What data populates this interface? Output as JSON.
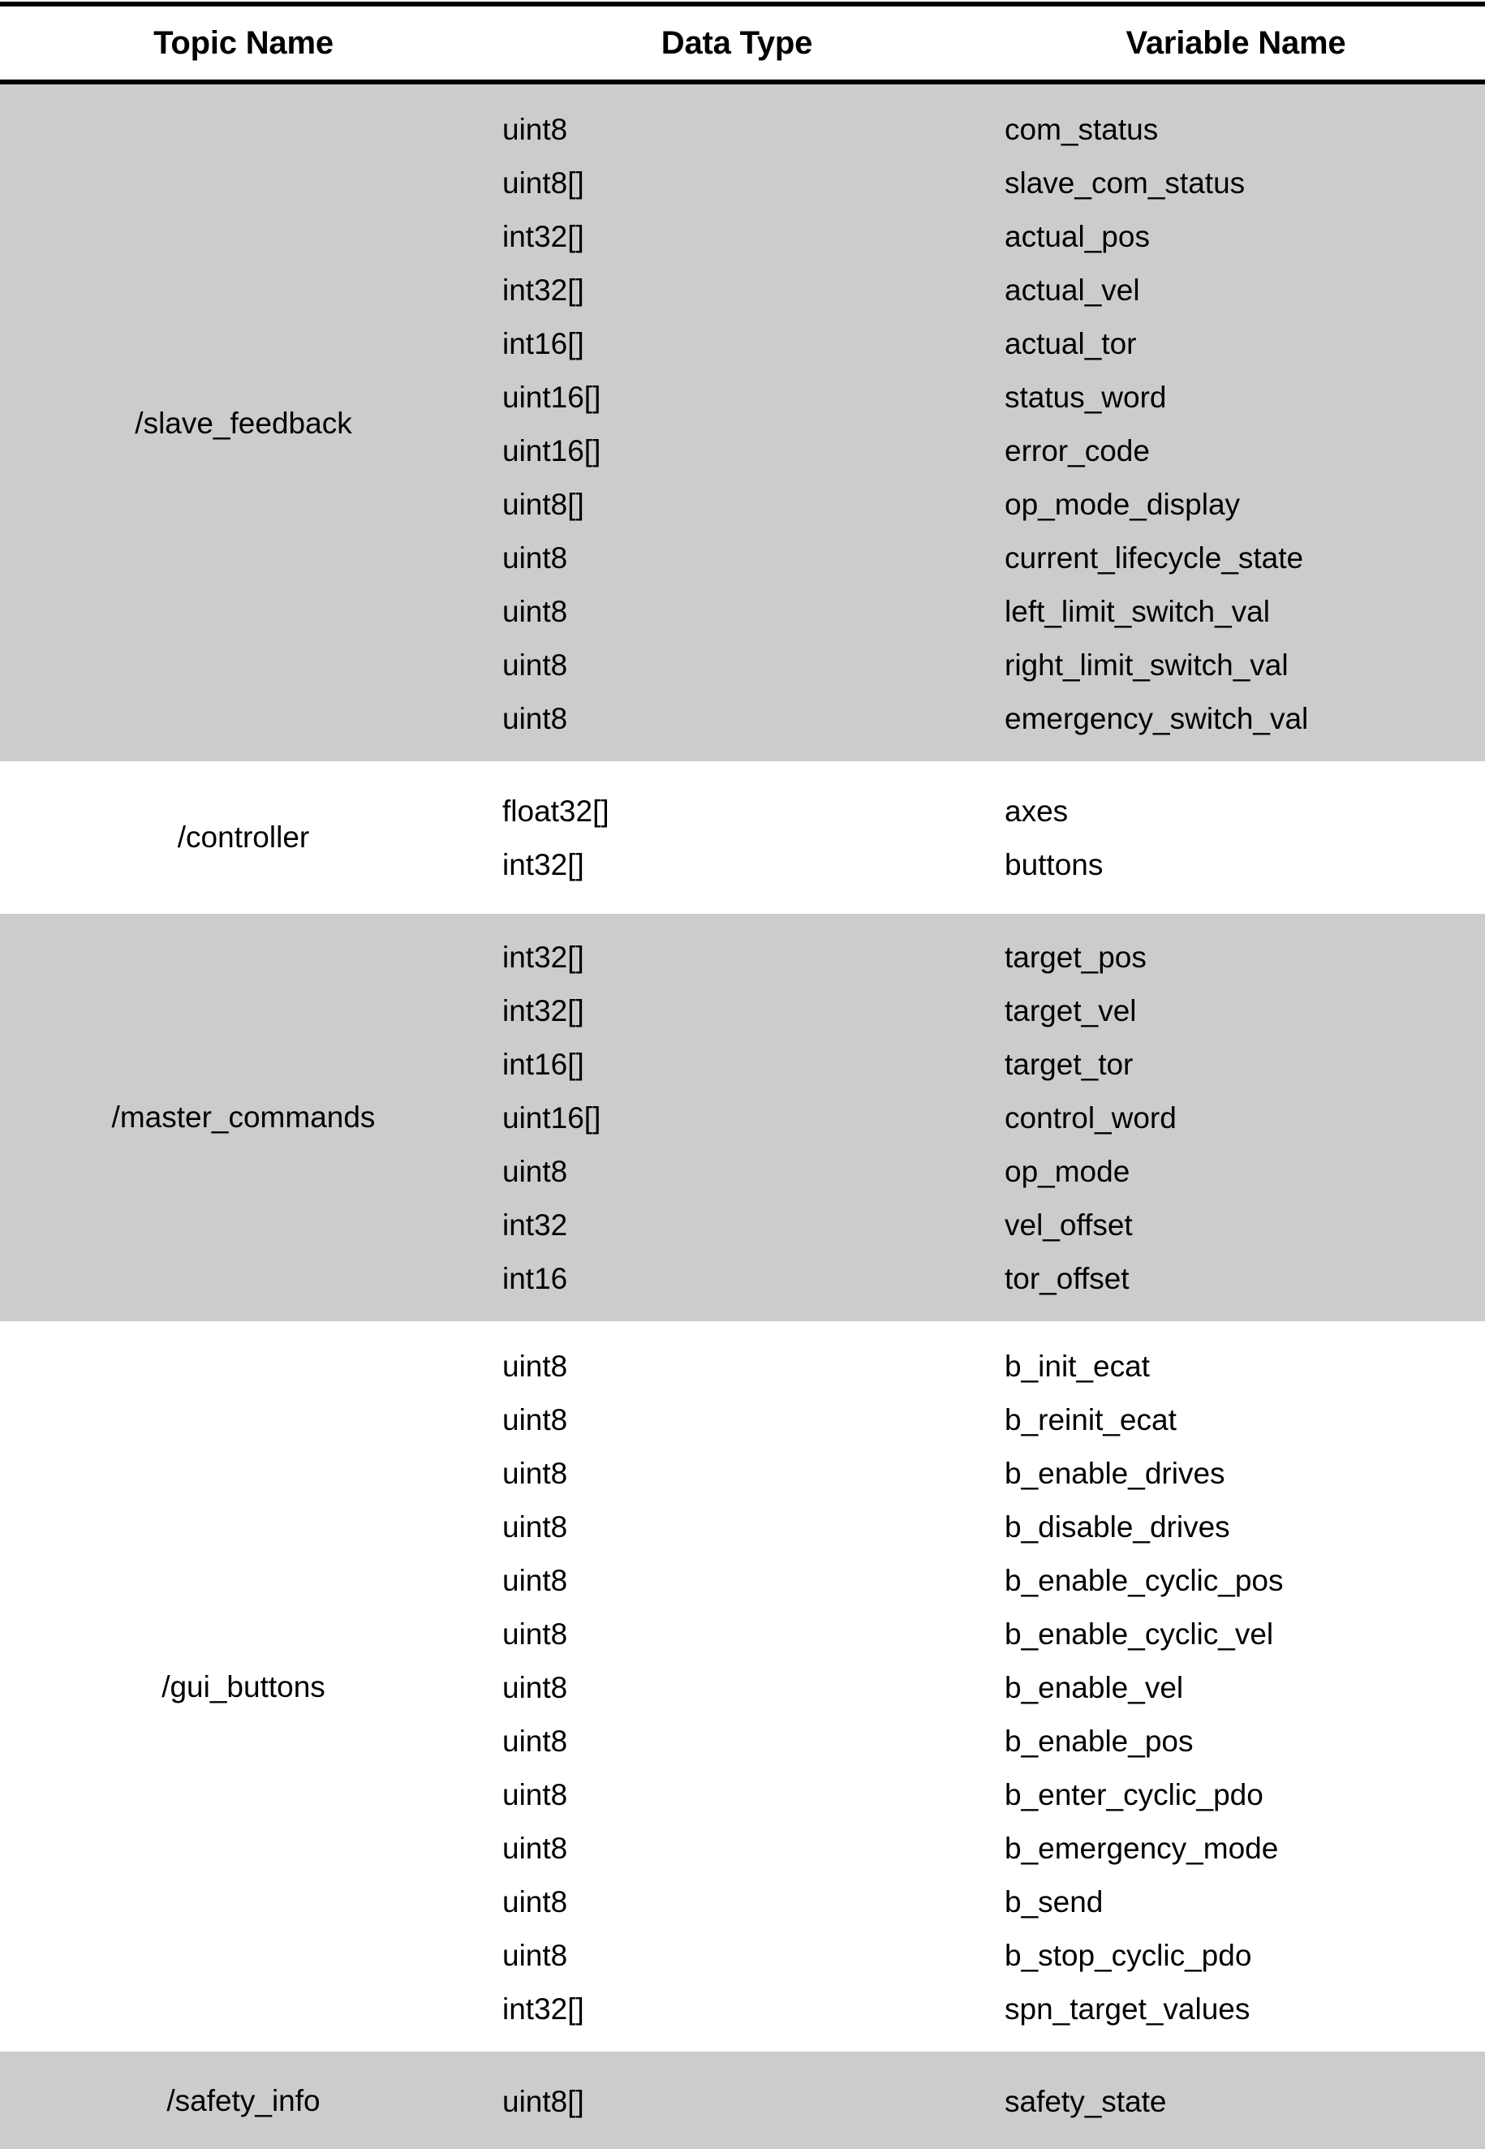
{
  "table": {
    "header": {
      "topic_name": "Topic Name",
      "data_type": "Data Type",
      "variable_name": "Variable Name"
    },
    "colors": {
      "shaded_row": "#CCCCCC",
      "plain_row": "#FFFFFF",
      "rule": "#000000",
      "text": "#000000"
    },
    "sections": [
      {
        "topic": "/slave_feedback",
        "shaded": true,
        "rows": [
          {
            "type": "uint8",
            "variable": "com_status"
          },
          {
            "type": "uint8[]",
            "variable": "slave_com_status"
          },
          {
            "type": "int32[]",
            "variable": "actual_pos"
          },
          {
            "type": "int32[]",
            "variable": "actual_vel"
          },
          {
            "type": "int16[]",
            "variable": "actual_tor"
          },
          {
            "type": "uint16[]",
            "variable": "status_word"
          },
          {
            "type": "uint16[]",
            "variable": "error_code"
          },
          {
            "type": "uint8[]",
            "variable": "op_mode_display"
          },
          {
            "type": "uint8",
            "variable": "current_lifecycle_state"
          },
          {
            "type": "uint8",
            "variable": "left_limit_switch_val"
          },
          {
            "type": "uint8",
            "variable": "right_limit_switch_val"
          },
          {
            "type": "uint8",
            "variable": "emergency_switch_val"
          }
        ]
      },
      {
        "topic": "/controller",
        "shaded": false,
        "rows": [
          {
            "type": "float32[]",
            "variable": "axes"
          },
          {
            "type": "int32[]",
            "variable": "buttons"
          }
        ]
      },
      {
        "topic": "/master_commands",
        "shaded": true,
        "rows": [
          {
            "type": "int32[]",
            "variable": "target_pos"
          },
          {
            "type": "int32[]",
            "variable": "target_vel"
          },
          {
            "type": "int16[]",
            "variable": "target_tor"
          },
          {
            "type": "uint16[]",
            "variable": "control_word"
          },
          {
            "type": "uint8",
            "variable": "op_mode"
          },
          {
            "type": "int32",
            "variable": "vel_offset"
          },
          {
            "type": "int16",
            "variable": "tor_offset"
          }
        ]
      },
      {
        "topic": "/gui_buttons",
        "shaded": false,
        "rows": [
          {
            "type": "uint8",
            "variable": "b_init_ecat"
          },
          {
            "type": "uint8",
            "variable": "b_reinit_ecat"
          },
          {
            "type": "uint8",
            "variable": "b_enable_drives"
          },
          {
            "type": "uint8",
            "variable": "b_disable_drives"
          },
          {
            "type": "uint8",
            "variable": "b_enable_cyclic_pos"
          },
          {
            "type": "uint8",
            "variable": "b_enable_cyclic_vel"
          },
          {
            "type": "uint8",
            "variable": "b_enable_vel"
          },
          {
            "type": "uint8",
            "variable": "b_enable_pos"
          },
          {
            "type": "uint8",
            "variable": "b_enter_cyclic_pdo"
          },
          {
            "type": "uint8",
            "variable": "b_emergency_mode"
          },
          {
            "type": "uint8",
            "variable": "b_send"
          },
          {
            "type": "uint8",
            "variable": "b_stop_cyclic_pdo"
          },
          {
            "type": "int32[]",
            "variable": "spn_target_values"
          }
        ]
      },
      {
        "topic": "/safety_info",
        "shaded": true,
        "rows": [
          {
            "type": "uint8[]",
            "variable": "safety_state"
          }
        ]
      }
    ]
  }
}
